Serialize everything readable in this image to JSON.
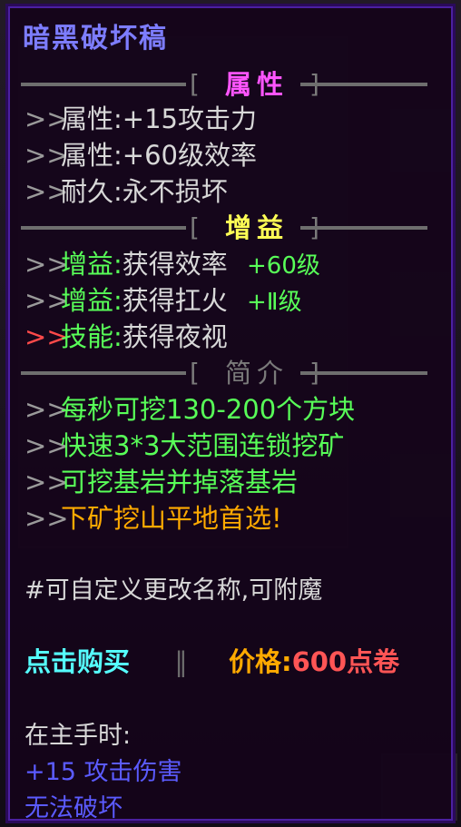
{
  "item_name": "暗黑破坏稿",
  "sections": {
    "attributes": {
      "header": "属性",
      "header_color": "#ff55ff",
      "lines": [
        {
          "arrow": ">>",
          "label": "属性:",
          "value": "+15攻击力"
        },
        {
          "arrow": ">>",
          "label": "属性:",
          "value": "+60级效率"
        },
        {
          "arrow": ">>",
          "label": "耐久:",
          "value": "永不损坏"
        }
      ]
    },
    "buffs": {
      "header": "增益",
      "header_color": "#ffff55",
      "lines": [
        {
          "arrow": ">>",
          "label": "增益:",
          "value": "获得效率",
          "level": "+60级"
        },
        {
          "arrow": ">>",
          "label": "增益:",
          "value": "获得扛火",
          "level": "+Ⅱ级"
        },
        {
          "arrow": ">>",
          "label": "技能:",
          "value": "获得夜视",
          "level": ""
        }
      ]
    },
    "intro": {
      "header": "简介",
      "header_color": "#7a7a7a",
      "lines": [
        {
          "arrow": ">>",
          "text": "每秒可挖130-200个方块"
        },
        {
          "arrow": ">>",
          "text": "快速3*3大范围连锁挖矿"
        },
        {
          "arrow": ">>",
          "text": "可挖基岩并掉落基岩"
        },
        {
          "arrow": ">>",
          "text": "下矿挖山平地首选!"
        }
      ]
    }
  },
  "bracket_left": "[",
  "bracket_right": "]",
  "custom_note": "#可自定义更改名称,可附魔",
  "purchase": {
    "buy_label": "点击购买",
    "separator": "‖",
    "price_label": "价格:",
    "price_value": "600点卷"
  },
  "mainhand": {
    "header": "在主手时:",
    "damage": "+15 攻击伤害",
    "unbreakable": "无法破坏"
  }
}
